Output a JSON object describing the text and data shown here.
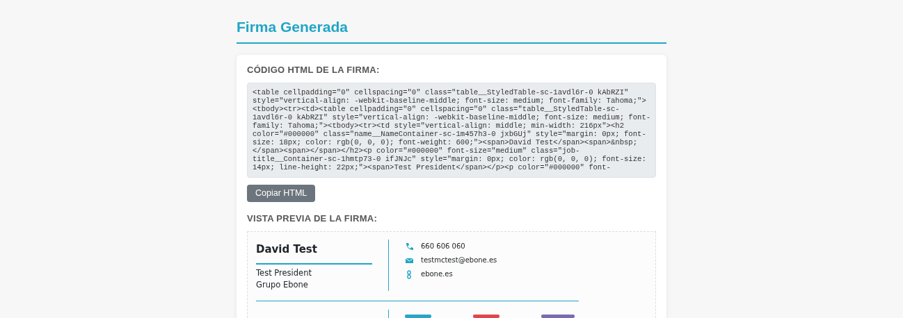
{
  "title": "Firma Generada",
  "code_section": {
    "heading": "CÓDIGO HTML DE LA FIRMA:",
    "lines": [
      "<table cellpadding=\"0\" cellspacing=\"0\" class=\"table__StyledTable-sc-1avdl6r-0 kAbRZI\"",
      "style=\"vertical-align: -webkit-baseline-middle; font-size: medium; font-family: Tahoma;\">",
      "<tbody><tr><td><table cellpadding=\"0\" cellspacing=\"0\" class=\"table__StyledTable-sc-",
      "1avdl6r-0 kAbRZI\" style=\"vertical-align: -webkit-baseline-middle; font-size: medium; font-",
      "family: Tahoma;\"><tbody><tr><td style=\"vertical-align: middle; min-width: 216px\"><h2",
      "color=\"#000000\" class=\"name__NameContainer-sc-1m457h3-0 jxbGUj\" style=\"margin: 0px; font-",
      "size: 18px; color: rgb(0, 0, 0); font-weight: 600;\"><span>David Test</span><span>&nbsp;",
      "</span><span></span></h2><p color=\"#000000\" font-size=\"medium\" class=\"job-",
      "title__Container-sc-1hmtp73-0 ifJNJc\" style=\"margin: 0px; color: rgb(0, 0, 0); font-size:",
      "14px; line-height: 22px;\"><span>Test President</span></p><p color=\"#000000\" font-"
    ],
    "button": "Copiar HTML"
  },
  "preview_section": {
    "heading": "VISTA PREVIA DE LA FIRMA:",
    "name": "David Test",
    "job_title": "Test President",
    "company": "Grupo Ebone",
    "contacts": [
      {
        "kind": "phone",
        "text": "660 606 060"
      },
      {
        "kind": "email",
        "text": "testmctest@ebone.es"
      },
      {
        "kind": "website",
        "text": "ebone.es"
      }
    ],
    "logos": [
      {
        "color": "#2aa5c9"
      },
      {
        "color": "#e0474c"
      },
      {
        "color": "#7b6bb0"
      }
    ]
  }
}
